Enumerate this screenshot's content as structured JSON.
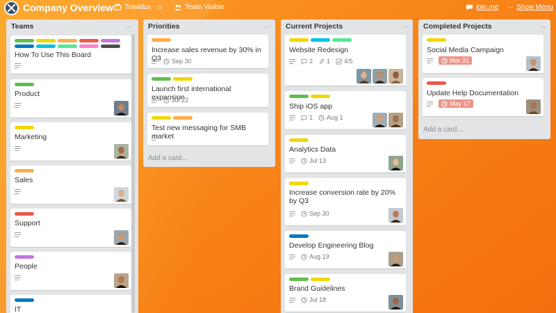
{
  "header": {
    "title": "Company Overview",
    "org": "Travidux",
    "visibility": "Team Visible",
    "join": "join.me",
    "menu": "Show Menu"
  },
  "colors": {
    "green": "#61bd4f",
    "yellow": "#f2d600",
    "orange": "#ffab4a",
    "red": "#eb5a46",
    "purple": "#c377e0",
    "blue": "#0079bf",
    "sky": "#00c2e0",
    "lime": "#51e898",
    "pink": "#ff80ce",
    "black": "#4d4d4d"
  },
  "lists": [
    {
      "title": "Teams",
      "cards": [
        {
          "title": "How To Use This Board",
          "labels": [
            "green",
            "yellow",
            "orange",
            "red",
            "purple",
            "blue",
            "sky",
            "lime",
            "pink",
            "black"
          ]
        },
        {
          "title": "Product",
          "labels": [
            "green"
          ]
        },
        {
          "title": "Marketing",
          "labels": [
            "yellow"
          ]
        },
        {
          "title": "Sales",
          "labels": [
            "orange"
          ]
        },
        {
          "title": "Support",
          "labels": [
            "red"
          ]
        },
        {
          "title": "People",
          "labels": [
            "purple"
          ]
        },
        {
          "title": "IT",
          "labels": [
            "blue"
          ]
        }
      ]
    },
    {
      "title": "Priorities",
      "cards": [
        {
          "title": "Increase sales revenue by 30% in Q3",
          "labels": [
            "orange"
          ],
          "due": "Sep 30"
        },
        {
          "title": "Launch first international expansion",
          "labels": [
            "green",
            "yellow"
          ],
          "due": "Jul 22"
        },
        {
          "title": "Test new messaging for SMB market",
          "labels": [
            "yellow",
            "orange"
          ]
        }
      ],
      "add_card": "Add a card…"
    },
    {
      "title": "Current Projects",
      "cards": [
        {
          "title": "Website Redesign",
          "labels": [
            "yellow",
            "sky",
            "lime"
          ],
          "comments": "2",
          "attachments": "1",
          "checklist": "4/5"
        },
        {
          "title": "Ship iOS app",
          "labels": [
            "green",
            "yellow"
          ],
          "comments": "1",
          "due": "Aug 1"
        },
        {
          "title": "Analytics Data",
          "labels": [
            "yellow"
          ],
          "due": "Jul 13"
        },
        {
          "title": "Increase conversion rate by 20% by Q3",
          "labels": [
            "yellow"
          ],
          "due": "Sep 30"
        },
        {
          "title": "Develop Engineering Blog",
          "labels": [
            "blue"
          ],
          "due": "Aug 19"
        },
        {
          "title": "Brand Guidelines",
          "labels": [
            "green",
            "yellow"
          ],
          "due": "Jul 18"
        }
      ]
    },
    {
      "title": "Completed Projects",
      "cards": [
        {
          "title": "Social Media Campaign",
          "labels": [
            "yellow"
          ],
          "due": "Mar 31"
        },
        {
          "title": "Update Help Documentation",
          "labels": [
            "red"
          ],
          "due": "May 17"
        }
      ],
      "add_card": "Add a card…"
    }
  ],
  "list_menu_glyph": "···"
}
